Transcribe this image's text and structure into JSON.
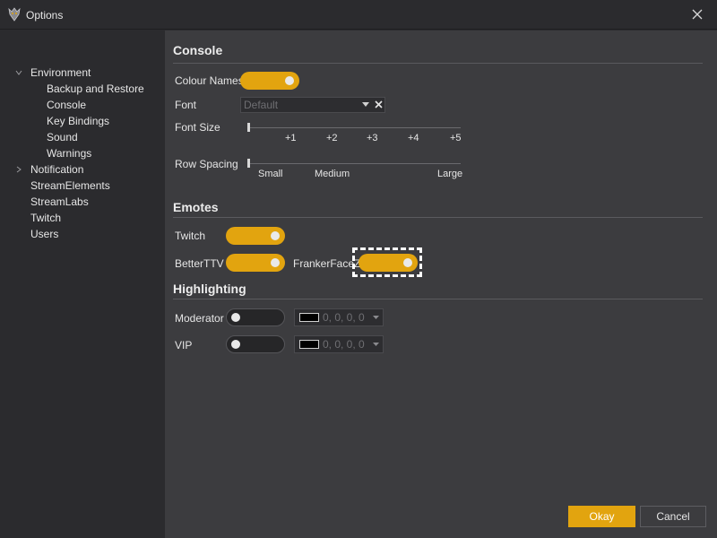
{
  "window": {
    "title": "Options",
    "icon": "app-logo-icon",
    "close_icon": "close-icon"
  },
  "sidebar": {
    "items": [
      {
        "label": "Environment",
        "expanded": true
      },
      {
        "label": "Backup and Restore"
      },
      {
        "label": "Console"
      },
      {
        "label": "Key Bindings"
      },
      {
        "label": "Sound"
      },
      {
        "label": "Warnings"
      },
      {
        "label": "Notification",
        "expanded": false
      },
      {
        "label": "StreamElements"
      },
      {
        "label": "StreamLabs"
      },
      {
        "label": "Twitch"
      },
      {
        "label": "Users"
      }
    ]
  },
  "console": {
    "title": "Console",
    "colour_names": {
      "label": "Colour Names",
      "on": true
    },
    "font": {
      "label": "Font",
      "placeholder": "Default"
    },
    "font_size": {
      "label": "Font Size",
      "ticks": [
        "+1",
        "+2",
        "+3",
        "+4",
        "+5"
      ]
    },
    "row_spacing": {
      "label": "Row Spacing",
      "ticks": [
        "Small",
        "Medium",
        "Large"
      ]
    }
  },
  "emotes": {
    "title": "Emotes",
    "twitch": {
      "label": "Twitch",
      "on": true
    },
    "betterttv": {
      "label": "BetterTTV",
      "on": true
    },
    "frankerfacez": {
      "label": "FrankerFaceZ",
      "on": true
    }
  },
  "highlighting": {
    "title": "Highlighting",
    "moderator": {
      "label": "Moderator",
      "on": false,
      "color": "0, 0, 0, 0"
    },
    "vip": {
      "label": "VIP",
      "on": false,
      "color": "0, 0, 0, 0"
    }
  },
  "buttons": {
    "okay": "Okay",
    "cancel": "Cancel"
  },
  "colors": {
    "accent": "#e2a40f",
    "background": "#2b2b2e",
    "panel": "#3c3c3f"
  }
}
